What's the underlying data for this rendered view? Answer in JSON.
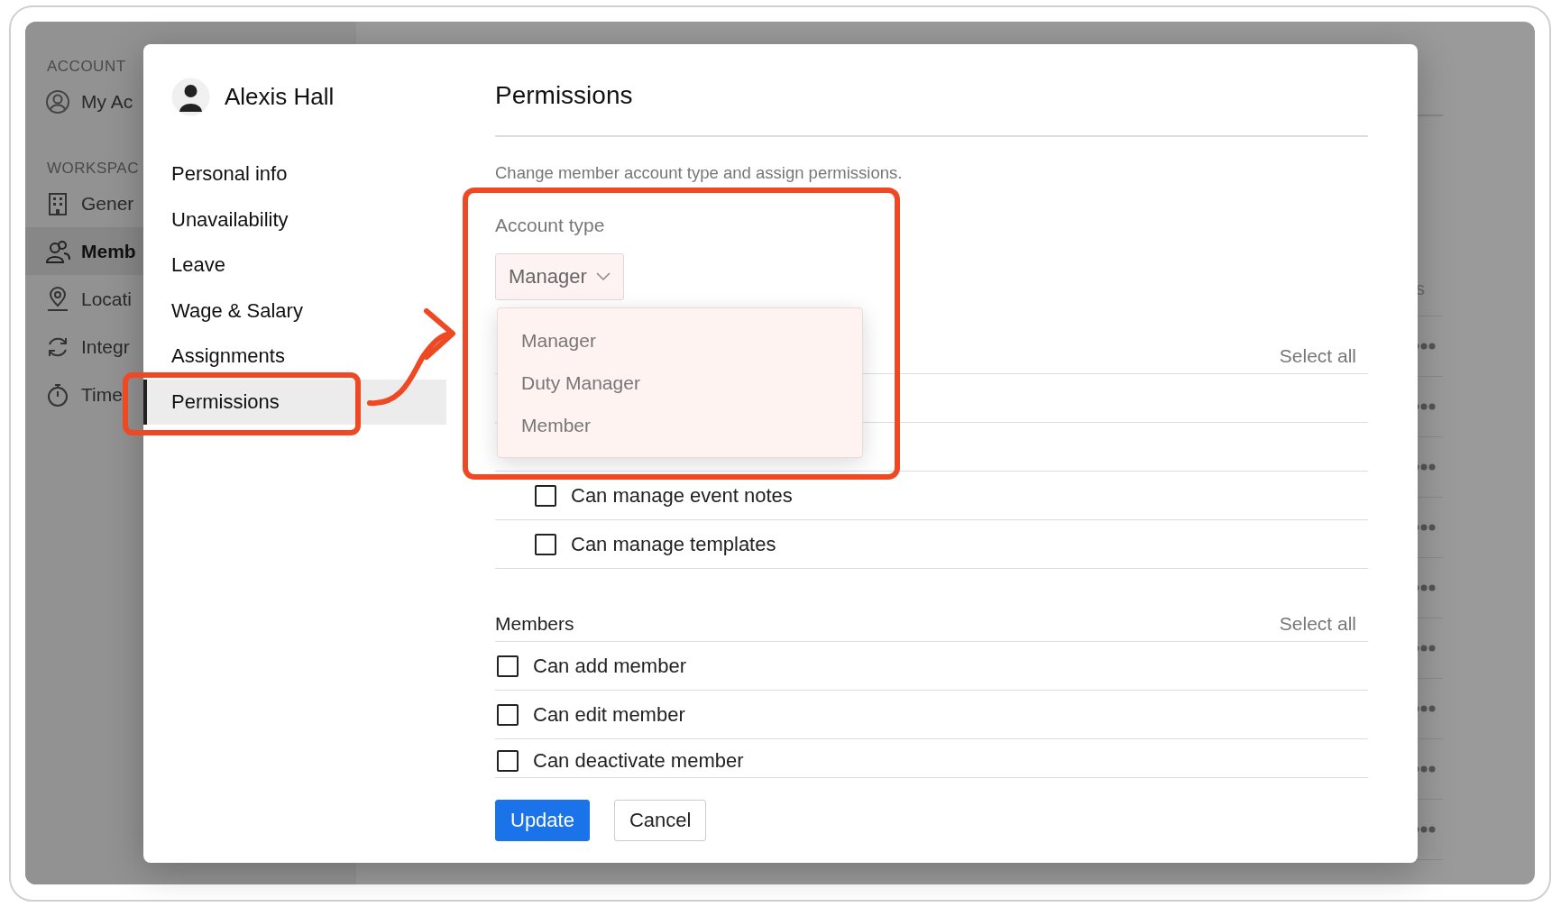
{
  "background": {
    "sidebar": {
      "sections": [
        {
          "heading": "ACCOUNT",
          "items": [
            {
              "label": "My Ac",
              "selected": false
            }
          ]
        },
        {
          "heading": "WORKSPAC",
          "items": [
            {
              "label": "Gener",
              "selected": false
            },
            {
              "label": "Memb",
              "selected": true
            },
            {
              "label": "Locati",
              "selected": false
            },
            {
              "label": "Integr",
              "selected": false
            },
            {
              "label": "Time",
              "selected": false
            }
          ]
        }
      ]
    },
    "table": {
      "column_header": "s",
      "rows": [
        {
          "kind": "menu"
        },
        {
          "kind": "menu"
        },
        {
          "kind": "menu"
        },
        {
          "kind": "menu"
        },
        {
          "kind": "menu"
        },
        {
          "kind": "menu"
        },
        {
          "kind": "menu"
        },
        {
          "kind": "menu"
        },
        {
          "kind": "menu"
        }
      ]
    }
  },
  "dialog": {
    "user": {
      "name": "Alexis Hall"
    },
    "nav": [
      {
        "label": "Personal info",
        "selected": false
      },
      {
        "label": "Unavailability",
        "selected": false
      },
      {
        "label": "Leave",
        "selected": false
      },
      {
        "label": "Wage & Salary",
        "selected": false
      },
      {
        "label": "Assignments",
        "selected": false
      },
      {
        "label": "Permissions",
        "selected": true
      }
    ],
    "title": "Permissions",
    "description": "Change member account type and assign permissions.",
    "account_type": {
      "label": "Account type",
      "value": "Manager",
      "expanded": true,
      "options": [
        {
          "label": "Manager"
        },
        {
          "label": "Duty Manager"
        },
        {
          "label": "Member"
        }
      ]
    },
    "sections": [
      {
        "kind": "nested",
        "select_all": "Select all",
        "permissions": [
          {
            "label": "Can manage event notes",
            "checked": false
          },
          {
            "label": "Can manage templates",
            "checked": false
          }
        ]
      },
      {
        "kind": "plain",
        "title": "Members",
        "select_all": "Select all",
        "permissions": [
          {
            "label": "Can add member",
            "checked": false
          },
          {
            "label": "Can edit member",
            "checked": false
          },
          {
            "label": "Can deactivate member",
            "checked": false
          }
        ]
      }
    ],
    "buttons": [
      {
        "label": "Update",
        "kind": "primary"
      },
      {
        "label": "Cancel",
        "kind": "secondary"
      }
    ]
  }
}
